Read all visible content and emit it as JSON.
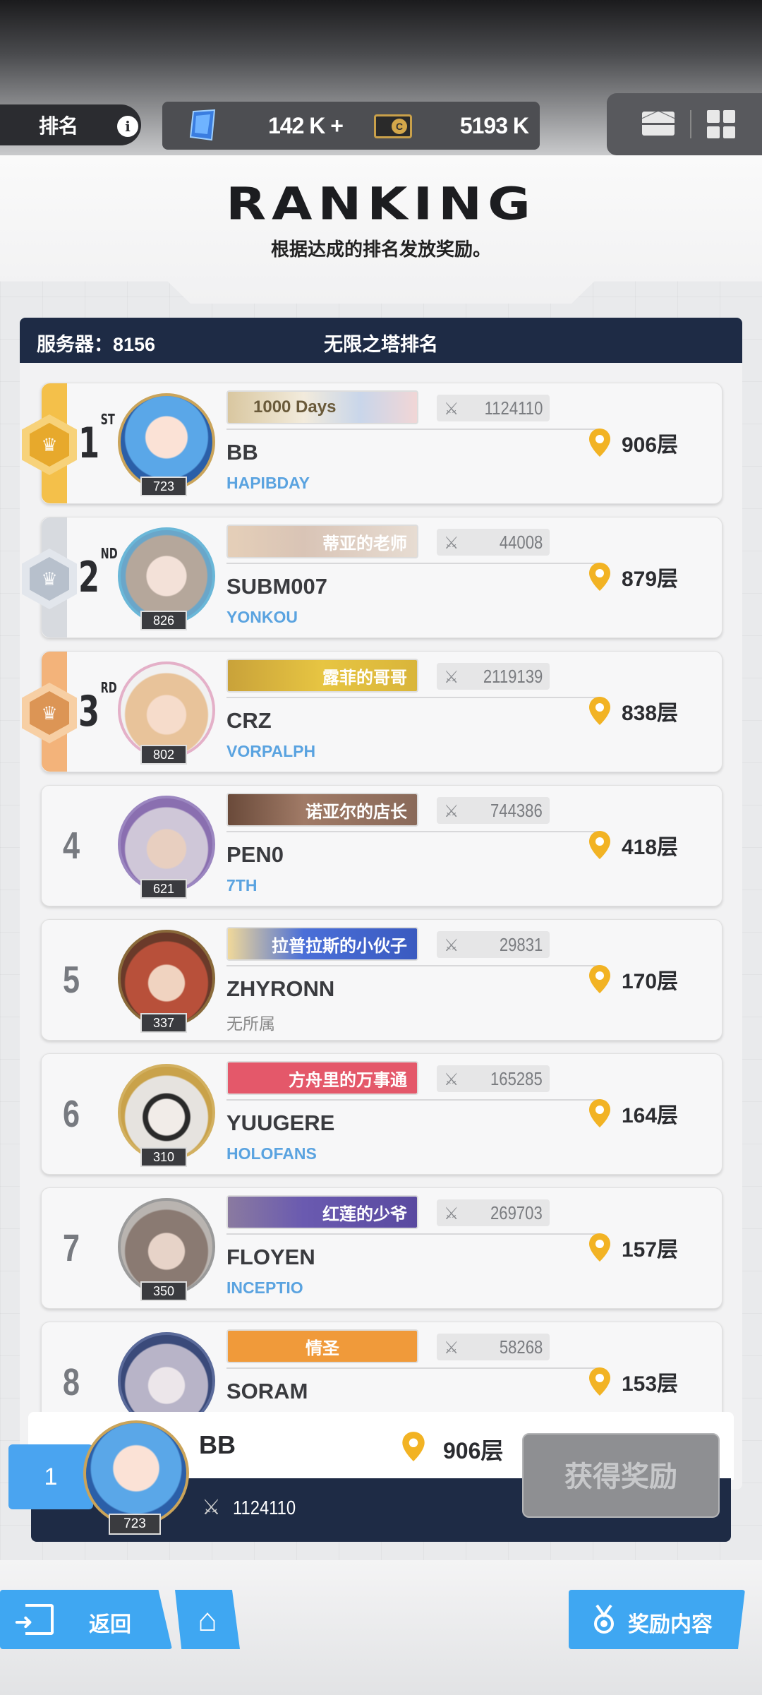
{
  "top": {
    "rank_label": "排名",
    "gems": "142 K +",
    "credits": "5193 K"
  },
  "header": {
    "title": "RANKING",
    "subtitle": "根据达成的排名发放奖励。"
  },
  "list": {
    "server": "服务器：8156",
    "title": "无限之塔排名"
  },
  "rows": [
    {
      "rank": "1",
      "suffix": "ST",
      "level": "723",
      "title_badge": "1000 Days",
      "power": "1124110",
      "name": "BB",
      "guild": "HAPIBDAY",
      "floor": "906层"
    },
    {
      "rank": "2",
      "suffix": "ND",
      "level": "826",
      "title_badge": "蒂亚的老师",
      "power": "44008",
      "name": "SUBM007",
      "guild": "YONKOU",
      "floor": "879层"
    },
    {
      "rank": "3",
      "suffix": "RD",
      "level": "802",
      "title_badge": "露菲的哥哥",
      "power": "2119139",
      "name": "CRZ",
      "guild": "VORPALPH",
      "floor": "838层"
    },
    {
      "rank": "4",
      "level": "621",
      "title_badge": "诺亚尔的店长",
      "power": "744386",
      "name": "PEN0",
      "guild": "7TH",
      "floor": "418层"
    },
    {
      "rank": "5",
      "level": "337",
      "title_badge": "拉普拉斯的小伙子",
      "power": "29831",
      "name": "ZHYRONN",
      "guild": "无所属",
      "floor": "170层"
    },
    {
      "rank": "6",
      "level": "310",
      "title_badge": "方舟里的万事通",
      "power": "165285",
      "name": "YUUGERE",
      "guild": "HOLOFANS",
      "floor": "164层"
    },
    {
      "rank": "7",
      "level": "350",
      "title_badge": "红莲的少爷",
      "power": "269703",
      "name": "FLOYEN",
      "guild": "INCEPTIO",
      "floor": "157层"
    },
    {
      "rank": "8",
      "level": "",
      "title_badge": "情圣",
      "power": "58268",
      "name": "SORAM",
      "guild": "",
      "floor": "153层"
    }
  ],
  "me": {
    "rank": "1",
    "level": "723",
    "name": "BB",
    "floor": "906层",
    "power": "1124110",
    "claim_label": "获得奖励"
  },
  "bottom": {
    "back_label": "返回",
    "reward_label": "奖励内容"
  },
  "colors": {
    "gold": "#f4c04a",
    "silver": "#c9ced6",
    "bronze": "#f3b37a",
    "navy": "#1e2b45",
    "accent_blue": "#3fa7f2",
    "guild_blue": "#5aa3e0"
  }
}
